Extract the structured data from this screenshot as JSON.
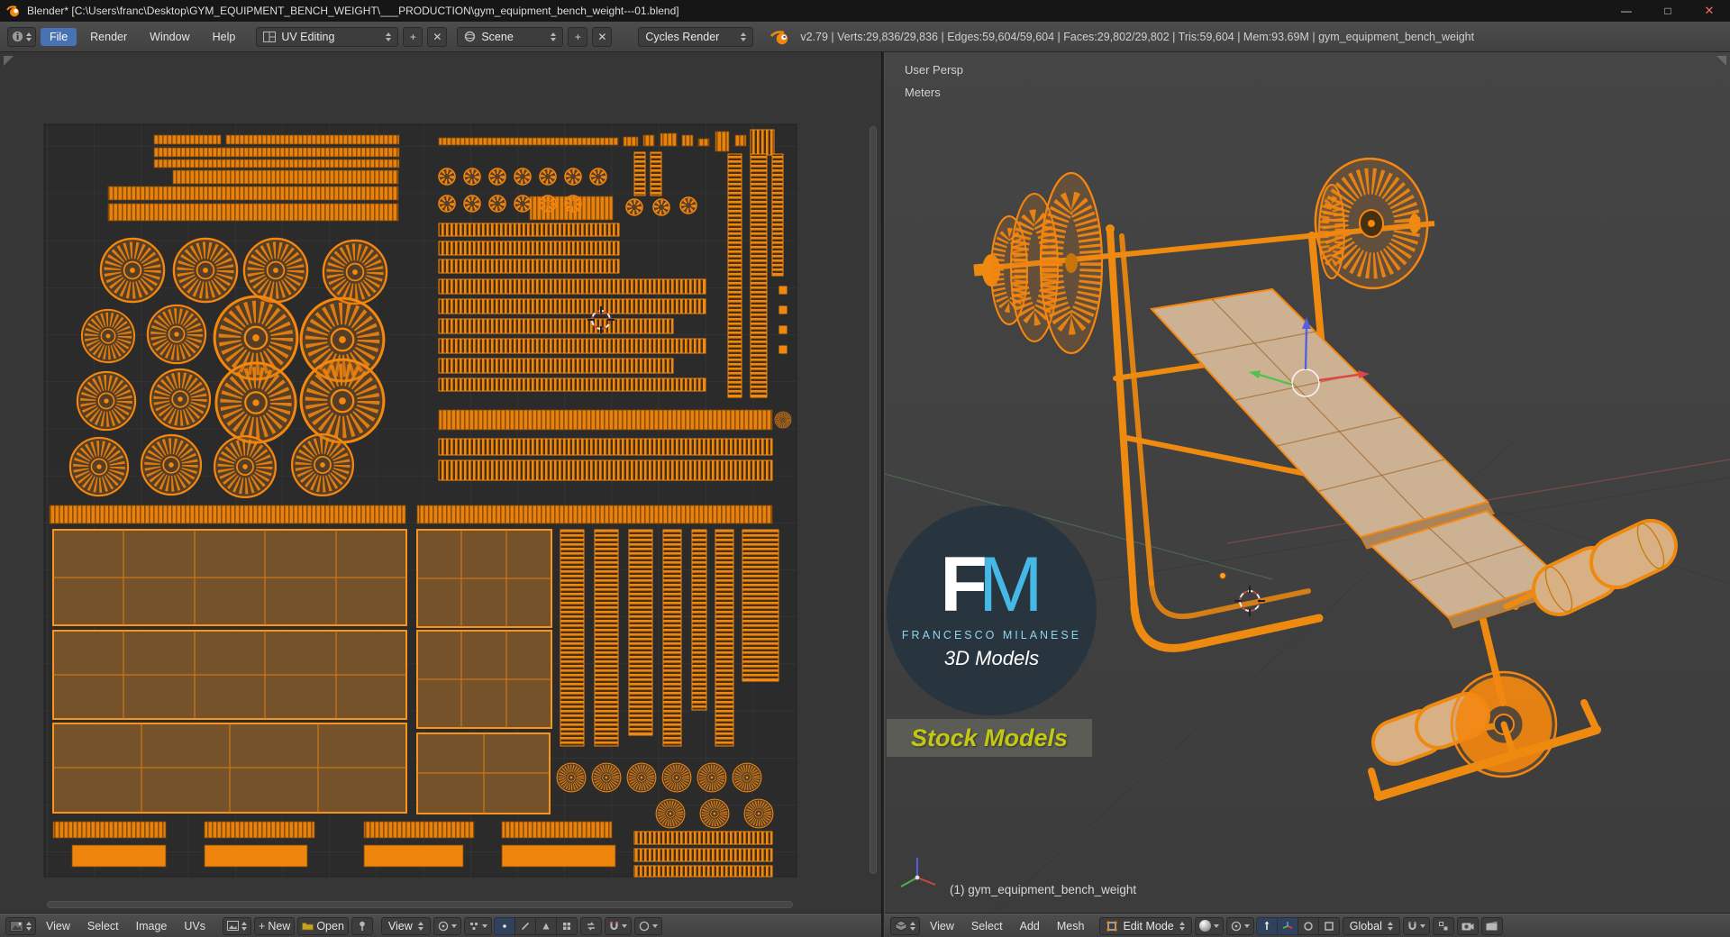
{
  "colors": {
    "accent_orange": "#f5870f",
    "selection_blue": "#4772b3",
    "uv_fill_brown": "#76522a",
    "bench_pad_tan": "#cdb193",
    "logo_cyan": "#45b8e6",
    "stock_models_yellow": "#c3c913"
  },
  "glyphs": {
    "minimize": "—",
    "maximize": "□",
    "close": "✕",
    "add": "+",
    "remove": "✕"
  },
  "titlebar": {
    "title": "Blender* [C:\\Users\\franc\\Desktop\\GYM_EQUIPMENT_BENCH_WEIGHT\\___PRODUCTION\\gym_equipment_bench_weight---01.blend]"
  },
  "infobar": {
    "menus": [
      "File",
      "Render",
      "Window",
      "Help"
    ],
    "layout_selector": {
      "value": "UV Editing"
    },
    "scene_selector": {
      "value": "Scene"
    },
    "engine_selector": {
      "value": "Cycles Render"
    },
    "stats": "v2.79 | Verts:29,836/29,836 | Edges:59,604/59,604 | Faces:29,802/29,802 | Tris:59,604 | Mem:93.69M | gym_equipment_bench_weight"
  },
  "uv_editor": {
    "footer": {
      "menus": [
        "View",
        "Select",
        "Image",
        "UVs"
      ],
      "new_button": "New",
      "open_button": "Open",
      "mode_selector": "View"
    }
  },
  "viewport": {
    "view_label": "User Persp",
    "units_label": "Meters",
    "object_info": "(1) gym_equipment_bench_weight",
    "footer": {
      "menus": [
        "View",
        "Select",
        "Add",
        "Mesh"
      ],
      "mode_selector": "Edit Mode",
      "orientation_selector": "Global"
    }
  },
  "watermark": {
    "logo_f": "F",
    "logo_m": "M",
    "brand": "FRANCESCO MILANESE",
    "subtitle": "3D Models",
    "badge": "Stock Models"
  }
}
